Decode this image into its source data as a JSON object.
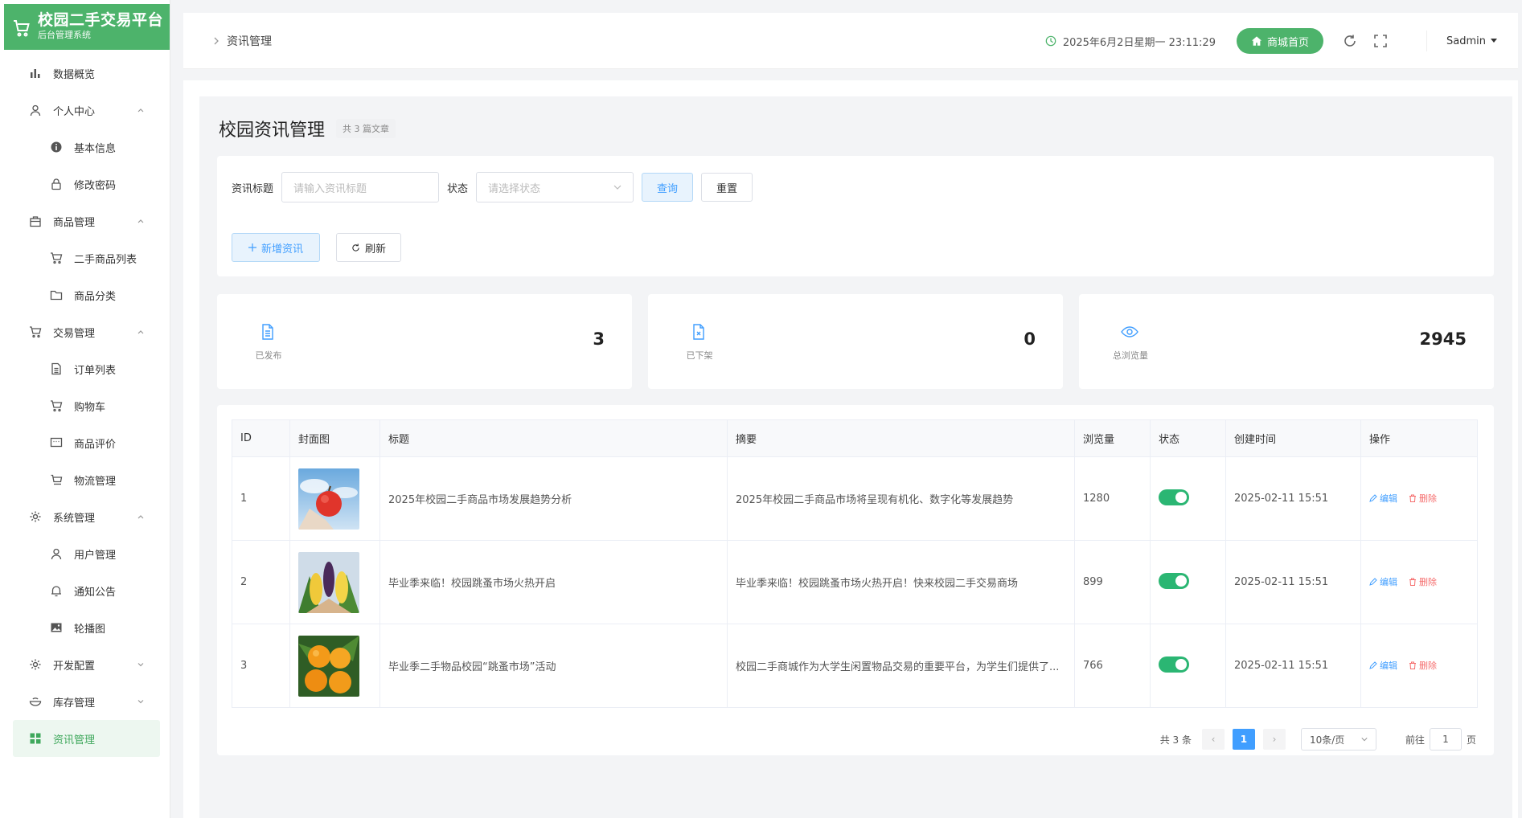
{
  "app": {
    "title": "校园二手交易平台",
    "subtitle": "后台管理系统"
  },
  "sidebar": {
    "items": [
      {
        "label": "数据概览",
        "level": "top",
        "icon": "bar-chart-icon"
      },
      {
        "label": "个人中心",
        "level": "top",
        "icon": "user-icon",
        "expanded": true
      },
      {
        "label": "基本信息",
        "level": "sub",
        "icon": "info-icon"
      },
      {
        "label": "修改密码",
        "level": "sub",
        "icon": "lock-icon"
      },
      {
        "label": "商品管理",
        "level": "top",
        "icon": "bag-icon",
        "expanded": true
      },
      {
        "label": "二手商品列表",
        "level": "sub",
        "icon": "cart-icon"
      },
      {
        "label": "商品分类",
        "level": "sub",
        "icon": "folder-icon"
      },
      {
        "label": "交易管理",
        "level": "top",
        "icon": "cart-icon",
        "expanded": true
      },
      {
        "label": "订单列表",
        "level": "sub",
        "icon": "document-icon"
      },
      {
        "label": "购物车",
        "level": "sub",
        "icon": "cart-icon"
      },
      {
        "label": "商品评价",
        "level": "sub",
        "icon": "comment-icon"
      },
      {
        "label": "物流管理",
        "level": "sub",
        "icon": "truck-icon"
      },
      {
        "label": "系统管理",
        "level": "top",
        "icon": "gear-icon",
        "expanded": true
      },
      {
        "label": "用户管理",
        "level": "sub",
        "icon": "user-icon"
      },
      {
        "label": "通知公告",
        "level": "sub",
        "icon": "bell-icon"
      },
      {
        "label": "轮播图",
        "level": "sub",
        "icon": "picture-icon"
      },
      {
        "label": "开发配置",
        "level": "top",
        "icon": "gear-icon",
        "expanded": false
      },
      {
        "label": "库存管理",
        "level": "top",
        "icon": "bowl-icon",
        "expanded": false
      },
      {
        "label": "资讯管理",
        "level": "top",
        "icon": "grid-icon",
        "active": true
      }
    ]
  },
  "header": {
    "breadcrumb": "资讯管理",
    "datetime": "2025年6月2日星期一 23:11:29",
    "home_label": "商城首页",
    "user": "Sadmin"
  },
  "page": {
    "title": "校园资讯管理",
    "count_badge": "共 3 篇文章"
  },
  "filters": {
    "title_label": "资讯标题",
    "title_placeholder": "请输入资讯标题",
    "status_label": "状态",
    "status_placeholder": "请选择状态",
    "query_label": "查询",
    "reset_label": "重置",
    "add_label": "新增资讯",
    "refresh_label": "刷新"
  },
  "stats": [
    {
      "label": "已发布",
      "value": "3",
      "icon": "document-icon"
    },
    {
      "label": "已下架",
      "value": "0",
      "icon": "document-x-icon"
    },
    {
      "label": "总浏览量",
      "value": "2945",
      "icon": "eye-icon"
    }
  ],
  "table": {
    "columns": [
      "ID",
      "封面图",
      "标题",
      "摘要",
      "浏览量",
      "状态",
      "创建时间",
      "操作"
    ],
    "edit_label": "编辑",
    "delete_label": "删除",
    "rows": [
      {
        "id": "1",
        "title": "2025年校园二手商品市场发展趋势分析",
        "summary": "2025年校园二手商品市场将呈现有机化、数字化等发展趋势",
        "views": "1280",
        "status": true,
        "created": "2025-02-11 15:51",
        "thumb": "apple"
      },
      {
        "id": "2",
        "title": "毕业季来临！校园跳蚤市场火热开启",
        "summary": "毕业季来临！校园跳蚤市场火热开启！快来校园二手交易商场",
        "views": "899",
        "status": true,
        "created": "2025-02-11 15:51",
        "thumb": "corn"
      },
      {
        "id": "3",
        "title": "毕业季二手物品校园“跳蚤市场”活动",
        "summary": "校园二手商城作为大学生闲置物品交易的重要平台，为学生们提供了...",
        "views": "766",
        "status": true,
        "created": "2025-02-11 15:51",
        "thumb": "orange"
      }
    ]
  },
  "pagination": {
    "total": "共 3 条",
    "current": "1",
    "page_size": "10条/页",
    "goto_prefix": "前往",
    "goto_value": "1",
    "goto_suffix": "页"
  },
  "colors": {
    "brand": "#4db36b",
    "primary": "#409eff",
    "danger": "#f56c6c",
    "switch": "#2bb673"
  }
}
